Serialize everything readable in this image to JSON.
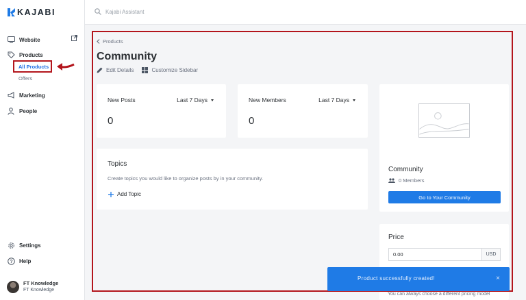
{
  "brand": {
    "name": "KAJABI",
    "accent": "#1f7be6",
    "highlight": "#b3151c"
  },
  "search": {
    "placeholder": "Kajabi Assistant",
    "icon": "search-icon"
  },
  "sidebar": {
    "items": [
      {
        "label": "Website",
        "icon": "monitor-icon"
      },
      {
        "label": "Products",
        "icon": "tag-icon"
      },
      {
        "label": "Marketing",
        "icon": "megaphone-icon"
      },
      {
        "label": "People",
        "icon": "person-icon"
      },
      {
        "label": "Settings",
        "icon": "gear-icon"
      },
      {
        "label": "Help",
        "icon": "question-icon"
      }
    ],
    "sub_items": [
      {
        "label": "All Products",
        "active": true
      },
      {
        "label": "Offers",
        "active": false
      }
    ],
    "profile": {
      "name": "FT Knowledge",
      "subtitle": "FT Knowledge"
    }
  },
  "main": {
    "breadcrumb": "Products",
    "title": "Community",
    "actions": {
      "edit": "Edit Details",
      "customize": "Customize Sidebar"
    },
    "stats": [
      {
        "label": "New Posts",
        "range": "Last 7 Days",
        "value": "0"
      },
      {
        "label": "New Members",
        "range": "Last 7 Days",
        "value": "0"
      }
    ],
    "topics": {
      "title": "Topics",
      "description": "Create topics you would like to organize posts by in your community.",
      "add_label": "Add Topic"
    },
    "community_card": {
      "title": "Community",
      "members": "0 Members",
      "button": "Go to Your Community"
    },
    "price_card": {
      "title": "Price",
      "value": "0.00",
      "currency": "USD",
      "note": "You can always choose a different pricing model"
    }
  },
  "toast": {
    "message": "Product successfully created!",
    "close": "×"
  }
}
